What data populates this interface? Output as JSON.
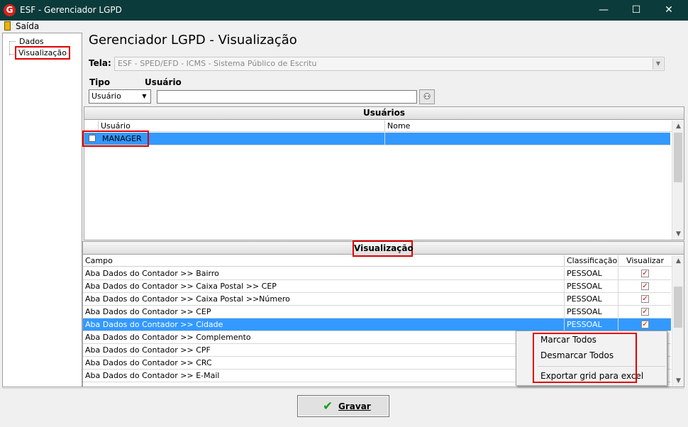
{
  "window": {
    "title": "ESF - Gerenciador LGPD",
    "app_icon_letter": "G"
  },
  "menu": {
    "exit_label": "Saída"
  },
  "tree": {
    "items": [
      "Dados",
      "Visualização"
    ]
  },
  "page": {
    "title": "Gerenciador LGPD - Visualização"
  },
  "tela": {
    "label": "Tela:",
    "value": "ESF - SPED/EFD - ICMS - Sistema Público de Escritu"
  },
  "filters": {
    "tipo_label": "Tipo",
    "usuario_label": "Usuário",
    "tipo_value": "Usuário",
    "usuario_value": ""
  },
  "users_panel": {
    "caption": "Usuários",
    "columns": [
      "Usuário",
      "Nome"
    ],
    "rows": [
      {
        "usuario": "MANAGER",
        "nome": ""
      }
    ]
  },
  "vis_panel": {
    "caption": "Visualização",
    "columns": [
      "Campo",
      "Classificação",
      "Visualizar"
    ],
    "rows": [
      {
        "campo": "Aba Dados do Contador >> Bairro",
        "classificacao": "PESSOAL",
        "visualizar": true
      },
      {
        "campo": "Aba Dados do Contador >> Caixa Postal >> CEP",
        "classificacao": "PESSOAL",
        "visualizar": true
      },
      {
        "campo": "Aba Dados do Contador >> Caixa Postal >>Número",
        "classificacao": "PESSOAL",
        "visualizar": true
      },
      {
        "campo": "Aba Dados do Contador >> CEP",
        "classificacao": "PESSOAL",
        "visualizar": true
      },
      {
        "campo": "Aba Dados do Contador >> Cidade",
        "classificacao": "PESSOAL",
        "visualizar": true
      },
      {
        "campo": "Aba Dados do Contador >> Complemento",
        "classificacao": "",
        "visualizar": null
      },
      {
        "campo": "Aba Dados do Contador >> CPF",
        "classificacao": "",
        "visualizar": null
      },
      {
        "campo": "Aba Dados do Contador >> CRC",
        "classificacao": "",
        "visualizar": null
      },
      {
        "campo": "Aba Dados do Contador >> E-Mail",
        "classificacao": "",
        "visualizar": null
      }
    ]
  },
  "context_menu": {
    "items": [
      "Marcar Todos",
      "Desmarcar Todos",
      "Exportar grid para excel"
    ]
  },
  "save_button": {
    "label": "Gravar"
  },
  "colors": {
    "titlebar": "#0b3b3a",
    "selection": "#3399ff",
    "highlight_box": "#e00000",
    "check": "#d40000"
  }
}
